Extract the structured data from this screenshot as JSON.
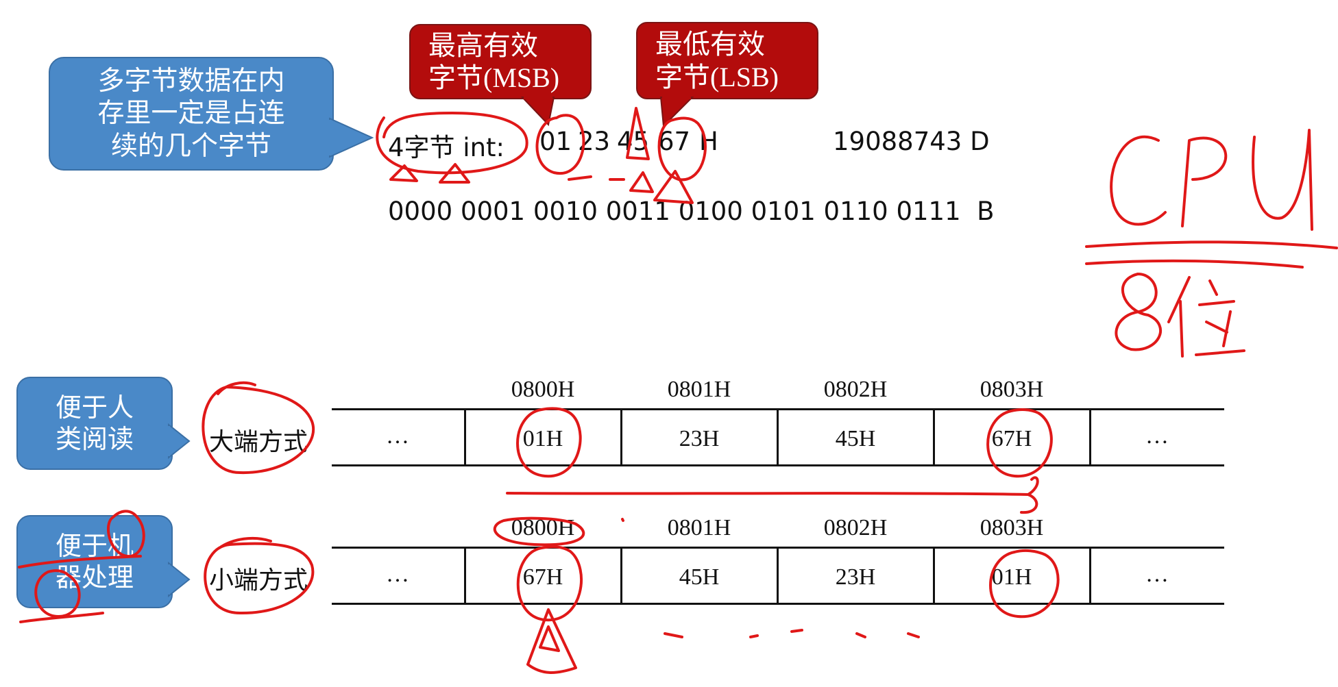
{
  "top_callout": {
    "lines": [
      "多字节数据在内",
      "存里一定是占连",
      "续的几个字节"
    ]
  },
  "msb_callout": {
    "lines": [
      "最高有效",
      "字节(MSB)"
    ]
  },
  "lsb_callout": {
    "lines": [
      "最低有效",
      "字节(LSB)"
    ]
  },
  "int_line": {
    "prefix": "4字节 int:",
    "bytes": [
      "01",
      "23",
      "45",
      "67"
    ],
    "hex_suffix": "H",
    "decimal": "19088743 D",
    "binary": "0000 0001 0010 0011 0100 0101 0110 0111  B"
  },
  "annotation_cpu": {
    "top": "CPU",
    "bottom": "8位"
  },
  "big_endian": {
    "callout": [
      "便于人",
      "类阅读"
    ],
    "label": "大端方式",
    "addresses": [
      "0800H",
      "0801H",
      "0802H",
      "0803H"
    ],
    "cells": [
      "01H",
      "23H",
      "45H",
      "67H"
    ],
    "ellipsis_left": "…",
    "ellipsis_right": "…"
  },
  "little_endian": {
    "callout": [
      "便于机",
      "器处理"
    ],
    "label": "小端方式",
    "addresses": [
      "0800H",
      "0801H",
      "0802H",
      "0803H"
    ],
    "cells": [
      "67H",
      "45H",
      "23H",
      "01H"
    ],
    "ellipsis_left": "…",
    "ellipsis_right": "…"
  },
  "colors": {
    "callout_blue": "#4a89c8",
    "callout_red": "#b30c0c",
    "ink_red": "#e01818"
  }
}
